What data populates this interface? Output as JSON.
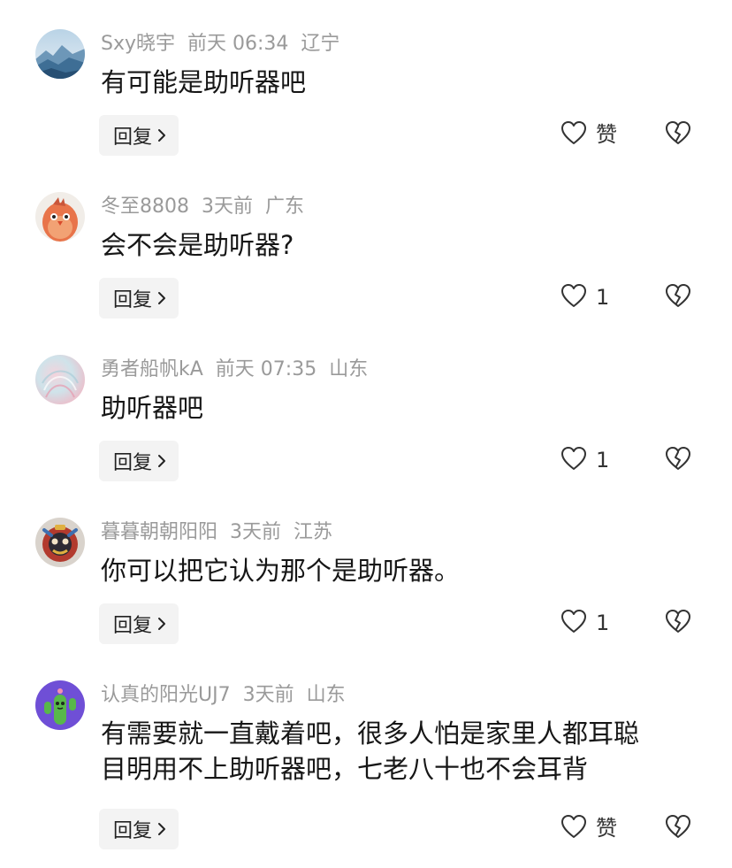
{
  "icons": {
    "reply_chevron": "chevron-right-icon",
    "like": "heart-outline-icon",
    "dislike": "broken-heart-icon"
  },
  "colors": {
    "meta_text": "#9a9a9a",
    "body_text": "#161616",
    "reply_bg": "#f3f3f3"
  },
  "comments": [
    {
      "username": "Sxy晓宇",
      "time": "前天 06:34",
      "location": "辽宁",
      "lines": [
        "有可能是助听器吧"
      ],
      "reply_label": "回复",
      "like_label": "赞",
      "avatar": "mountain-landscape"
    },
    {
      "username": "冬至8808",
      "time": "3天前",
      "location": "广东",
      "lines": [
        "会不会是助听器?"
      ],
      "reply_label": "回复",
      "like_label": "1",
      "avatar": "cartoon-bird"
    },
    {
      "username": "勇者船帆kA",
      "time": "前天 07:35",
      "location": "山东",
      "lines": [
        "助听器吧"
      ],
      "reply_label": "回复",
      "like_label": "1",
      "avatar": "pastel-swirl"
    },
    {
      "username": "暮暮朝朝阳阳",
      "time": "3天前",
      "location": "江苏",
      "lines": [
        "你可以把它认为那个是助听器。"
      ],
      "reply_label": "回复",
      "like_label": "1",
      "avatar": "lion-dance-figure"
    },
    {
      "username": "认真的阳光UJ7",
      "time": "3天前",
      "location": "山东",
      "lines": [
        "有需要就一直戴着吧，很多人怕是家里人都耳聪",
        "目明用不上助听器吧，七老八十也不会耳背"
      ],
      "reply_label": "回复",
      "like_label": "赞",
      "avatar": "cactus-character"
    }
  ]
}
